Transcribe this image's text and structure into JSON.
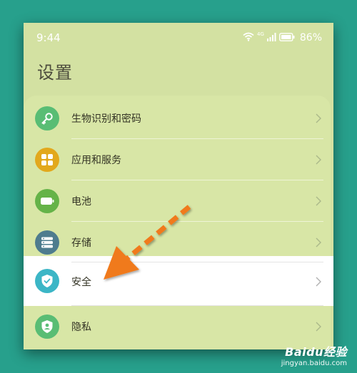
{
  "status_bar": {
    "time": "9:44",
    "network_label": "4G",
    "battery_percent": "86%"
  },
  "header": {
    "title": "设置"
  },
  "settings": {
    "items": [
      {
        "label": "生物识别和密码",
        "icon": "key-icon",
        "icon_color": "#59bd74"
      },
      {
        "label": "应用和服务",
        "icon": "apps-icon",
        "icon_color": "#e2a81c"
      },
      {
        "label": "电池",
        "icon": "battery-icon",
        "icon_color": "#65b348"
      },
      {
        "label": "存储",
        "icon": "storage-icon",
        "icon_color": "#4e7c8e"
      },
      {
        "label": "安全",
        "icon": "shield-icon",
        "icon_color": "#3cb6c6",
        "highlighted": true
      },
      {
        "label": "隐私",
        "icon": "privacy-icon",
        "icon_color": "#59bd74"
      }
    ]
  },
  "annotation": {
    "arrow_color": "#f07a1a"
  },
  "watermark": {
    "brand": "Baidu经验",
    "url": "jingyan.baidu.com"
  }
}
